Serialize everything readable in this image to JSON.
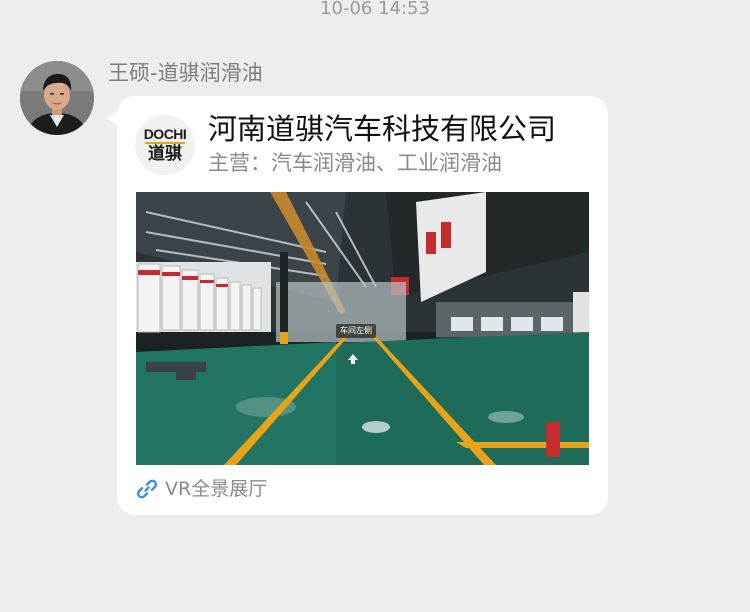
{
  "timestamp": "10-06 14:53",
  "sender": {
    "name": "王硕-道骐润滑油"
  },
  "card": {
    "logo_text_en": "DOCHI",
    "logo_text_cn": "道骐",
    "company_name": "河南道骐汽车科技有限公司",
    "business_label": "主营：汽车润滑油、工业润滑油",
    "panorama_tag": "车间左侧",
    "link_label": "VR全景展厅"
  },
  "colors": {
    "background": "#ededed",
    "bubble": "#ffffff",
    "link_icon": "#3a8ee6",
    "floor_green": "#1e6b5a",
    "floor_stripe": "#e8a317"
  },
  "icons": {
    "link": "link-icon",
    "pano_arrow": "arrow-up-icon"
  }
}
